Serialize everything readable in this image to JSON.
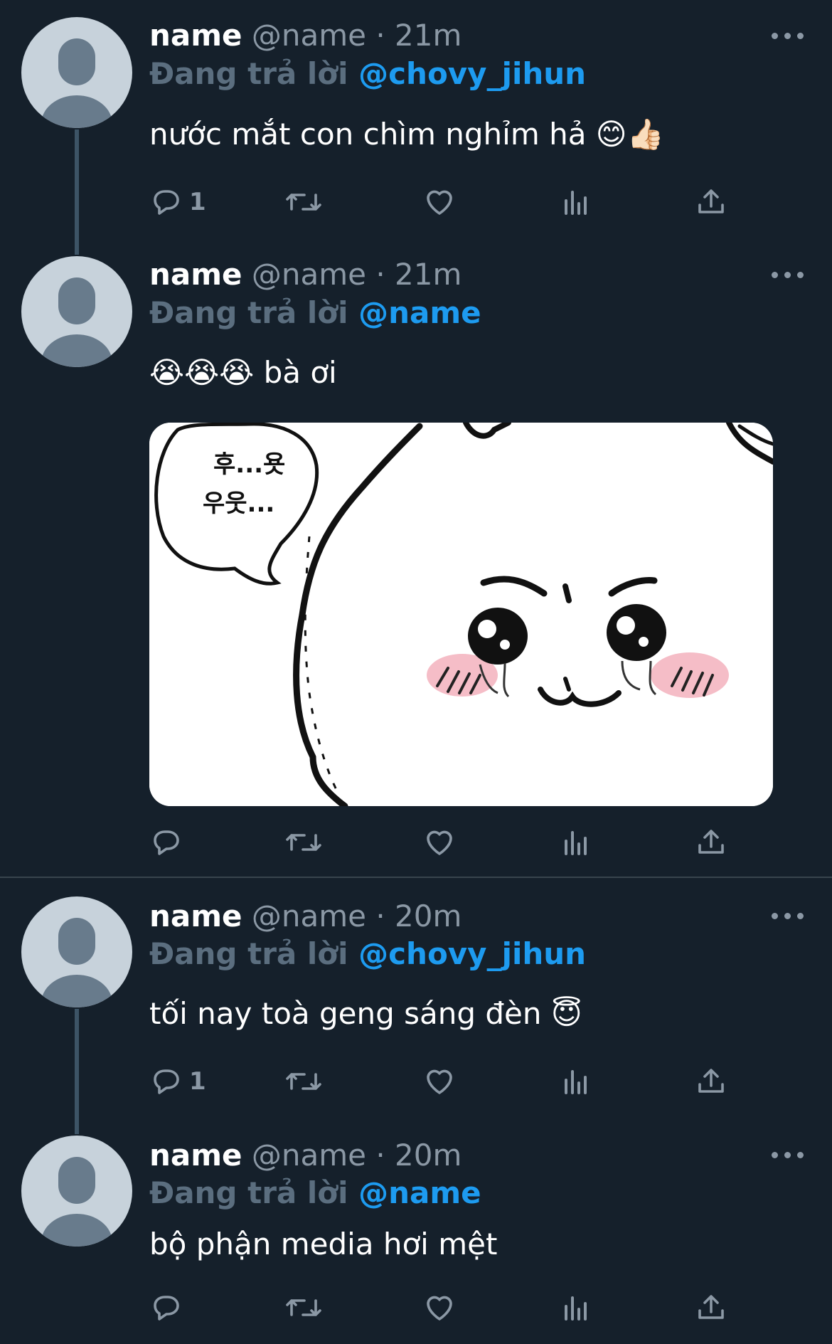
{
  "tweets": [
    {
      "display_name": "name",
      "handle": "@name",
      "time": "21m",
      "reply_prefix": "Đang trả lời",
      "reply_to": "@chovy_jihun",
      "text": "nước mắt con chìm nghỉm hả 😊👍🏻",
      "reply_count": "1"
    },
    {
      "display_name": "name",
      "handle": "@name",
      "time": "21m",
      "reply_prefix": "Đang trả lời",
      "reply_to": "@name",
      "text": "😭😭😭  bà ơi",
      "reply_count": "",
      "media": {
        "bubble_text_1": "후...욧",
        "bubble_text_2": "우웃..."
      }
    },
    {
      "display_name": "name",
      "handle": "@name",
      "time": "20m",
      "reply_prefix": "Đang trả lời",
      "reply_to": "@chovy_jihun",
      "text": "tối nay toà geng sáng đèn 😇",
      "reply_count": "1"
    },
    {
      "display_name": "name",
      "handle": "@name",
      "time": "20m",
      "reply_prefix": "Đang trả lời",
      "reply_to": "@name",
      "text": "bộ phận media hơi mệt",
      "reply_count": ""
    }
  ],
  "separator": "·",
  "icons": {
    "reply": "reply-icon",
    "retweet": "retweet-icon",
    "like": "heart-icon",
    "views": "views-icon",
    "share": "share-icon",
    "more": "more-icon"
  },
  "colors": {
    "background": "#15202b",
    "mention": "#1d9bf0",
    "muted": "#8b98a5",
    "divider": "#38444d"
  }
}
